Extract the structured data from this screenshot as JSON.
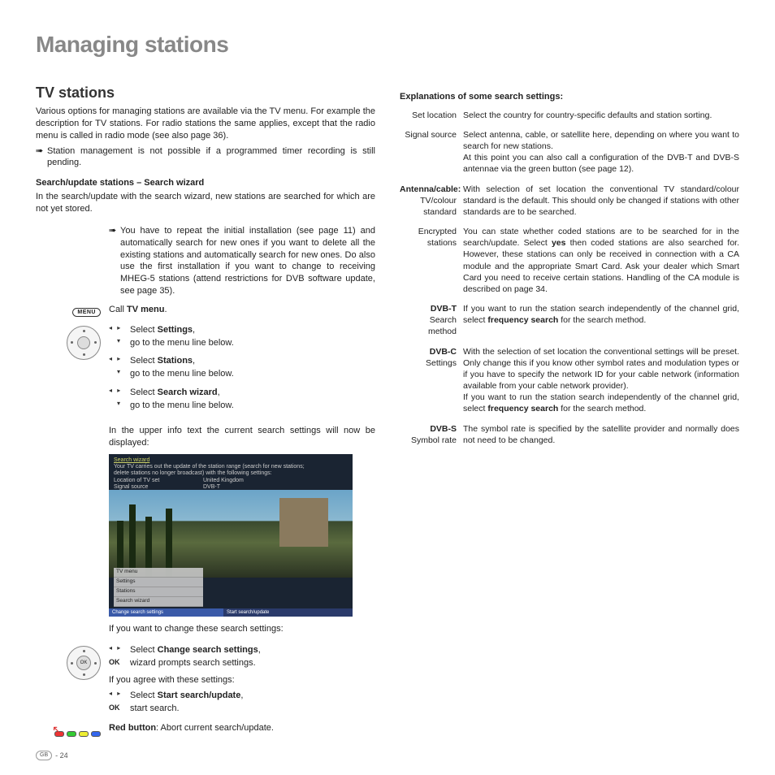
{
  "title": "Managing stations",
  "left": {
    "h2": "TV stations",
    "intro": "Various options for managing stations are available via the TV menu. For example the description for TV stations. For radio stations the same applies, except that the radio menu is called in radio mode (see also page 36).",
    "note1": "Station management is not possible if a programmed timer recording is still pending.",
    "sub1": "Search/update stations  – Search wizard",
    "sub1_text": "In the search/update with the search wizard, new stations are searched for which are not yet stored.",
    "note2": "You have to repeat the initial installation (see page 11) and automatically search for new ones if you want to delete all the existing stations and automatically search for new ones. Do also use the first installation if you want to change to receiving MHEG-5 stations (attend restrictions for DVB software update, see page 35).",
    "menu_label": "MENU",
    "call_tv": "Call ",
    "call_tv_b": "TV menu",
    "nav": [
      {
        "sel": "Select ",
        "b": "Settings",
        "after": ",",
        "down": "go to the menu line below."
      },
      {
        "sel": "Select ",
        "b": "Stations",
        "after": ",",
        "down": "go to the menu line below."
      },
      {
        "sel": "Select ",
        "b": "Search wizard",
        "after": ",",
        "down": "go to the menu line below."
      }
    ],
    "upper_info": "In the upper info text the current search settings will now be displayed:",
    "tv": {
      "title": "Search wizard",
      "line1": "Your TV carries out the update of the station range (search for new stations;",
      "line2": "delete stations no longer broadcast) with the following settings:",
      "loc_l": "Location of TV set",
      "loc_v": "United Kingdom",
      "src_l": "Signal source",
      "src_v": "DVB-T",
      "menu": [
        "TV menu",
        "Settings",
        "Stations",
        "Search wizard"
      ],
      "bar1": "Change search settings",
      "bar2": "Start search/update"
    },
    "if_change": "If you want to change these search settings:",
    "change_sel": "Select ",
    "change_b": "Change search settings",
    "change_after": ",",
    "change_ok": "wizard prompts search settings.",
    "if_agree": "If you agree with these settings:",
    "start_sel": "Select ",
    "start_b": "Start search/update",
    "start_after": ",",
    "start_ok": "start search.",
    "red_b": "Red button",
    "red_text": ": Abort current search/update."
  },
  "right": {
    "head": "Explanations of some search settings:",
    "defs": [
      {
        "l1": "Set location",
        "l2": "",
        "t": "Select the country for country-specific defaults and station sorting."
      },
      {
        "l1": "Signal source",
        "l2": "",
        "t": "Select antenna, cable, or satellite here, depending on where you want to search for new stations.\nAt this point you can also call a configuration of the DVB-T and DVB-S antennae via the green button (see page 12)."
      },
      {
        "l1b": "Antenna/cable:",
        "l2": "TV/colour",
        "l3": "standard",
        "t": "With selection of set location the conventional TV standard/colour standard is the default. This should only be changed if stations with other standards are to be searched."
      },
      {
        "l1": "Encrypted",
        "l2": "stations",
        "t": "You can state whether coded stations are to be searched for in the search/update. Select <b>yes</b> then coded stations are also searched for. However, these stations can only be received in connection with a CA module and the appropriate Smart Card. Ask your dealer which Smart Card you need to receive certain stations. Handling of the CA module is described on page 34."
      },
      {
        "l1b": "DVB-T",
        "l2": "Search method",
        "t": "If you want to run the station search independently of the channel grid, select <b>frequency search</b> for the search method."
      },
      {
        "l1b": "DVB-C",
        "l2": "Settings",
        "t": "With the selection of set location the conventional settings will be preset. Only change this if you know other symbol rates and modulation types or if you have to specify the network ID for your cable network (information available from your cable network provider).\nIf you want to run the station search independently of the channel grid, select <b>frequency search</b> for the search method."
      },
      {
        "l1b": "DVB-S",
        "l2": "Symbol rate",
        "t": "The symbol rate is specified by the satellite provider and normally does not need to be changed."
      }
    ]
  },
  "footer": {
    "gb": "GB",
    "page": "- 24"
  }
}
